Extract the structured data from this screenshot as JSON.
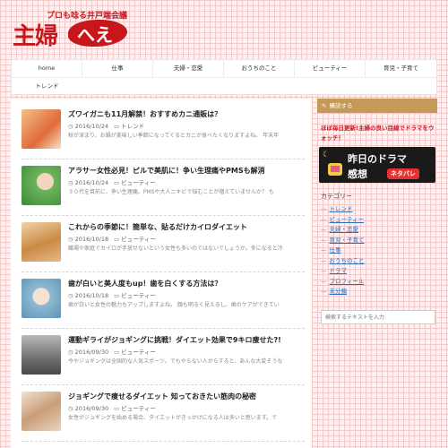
{
  "header": {
    "logo_kanji": "主婦",
    "logo_kana": "へえ",
    "tagline": "プロも唸る井戸端会議",
    "brand_color": "#c8161d"
  },
  "nav": {
    "items": [
      "home",
      "仕事",
      "夫婦・恋愛",
      "おうちのこと",
      "ビューティー",
      "育児・子育て",
      "トレンド"
    ]
  },
  "posts": [
    {
      "title": "ズワイガニも11月解禁！おすすめカニ通販は？",
      "date": "2016/10/24",
      "category": "トレンド",
      "excerpt": "秋が深まり、お鍋が美味しい季節になってくるとカニが食べたくなりますよね。 年末年",
      "thumb_color": "#e88a5a"
    },
    {
      "title": "アラサー女性必見！ピルで美肌に！争い生理痛やPMSも解消",
      "date": "2016/10/24",
      "category": "ビューティー",
      "excerpt": "３０代を目前に、争い生理痛、PMSや大人ニキビで悩むことが増えていませんか？ も",
      "thumb_color": "#7cbf6a"
    },
    {
      "title": "これからの季節に！簡単な、貼るだけカイロダイエット",
      "date": "2016/10/18",
      "category": "ビューティー",
      "excerpt": "職場や家庭でカイロが手放せないという女性も多いのではないでしょうか。冬になると冷",
      "thumb_color": "#d9a46a"
    },
    {
      "title": "歯が白いと美人度もup！歯を白くする方法は？",
      "date": "2016/10/18",
      "category": "ビューティー",
      "excerpt": "歯が白いと女性の魅力もアップしますよね。 顔も明るく見えるし、歯のケアができてい",
      "thumb_color": "#9fc3d8"
    },
    {
      "title": "運動ギライがジョギングに挑戦！ダイエット効果で9キロ痩せた?!",
      "date": "2016/09/30",
      "category": "ビューティー",
      "excerpt": "今やジョギングは全国的な人気スポーツ。でもやらない人からすると、あんな大変そうな",
      "thumb_color": "#8c8c8c"
    },
    {
      "title": "ジョギングで痩せるダイエット 知っておきたい筋肉の秘密",
      "date": "2016/09/30",
      "category": "ビューティー",
      "excerpt": "女性がジョギングを始める場合、ダイエットがきっかけになる人は多いと思います。で",
      "thumb_color": "#d7b79a"
    }
  ],
  "sidebar": {
    "widget_title": "購読する",
    "widget_text": "ほぼ毎日更新!主婦の良い目線でドラマをウォッチ！",
    "banner": {
      "line1": "昨日のドラマ",
      "line2": "感想",
      "badge": "ネタバレ"
    },
    "categories_title": "カテゴリー",
    "categories": [
      "トレンド",
      "ビューティー",
      "夫婦・恋愛",
      "育児・子育て",
      "仕事",
      "おうちのこと",
      "ドラマ",
      "プロフィール",
      "未分類"
    ],
    "search_placeholder": "検索するテキストを入力"
  }
}
